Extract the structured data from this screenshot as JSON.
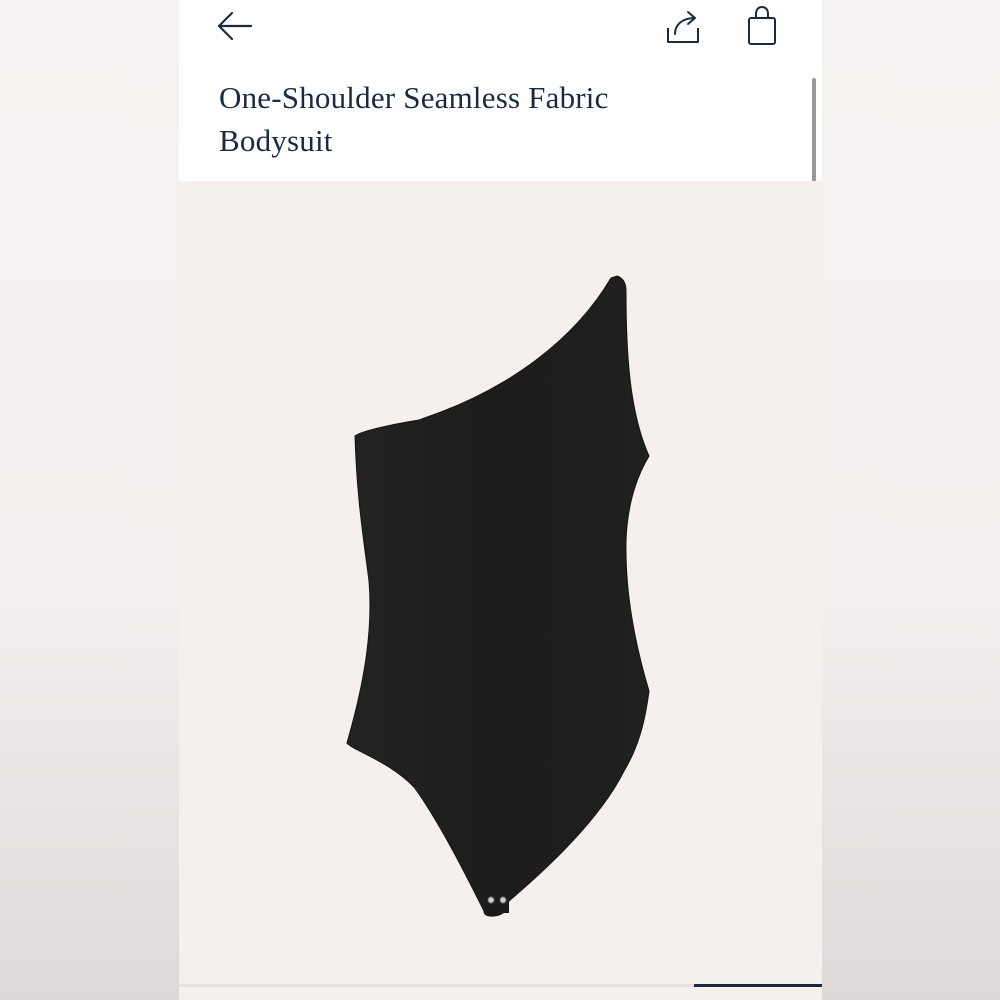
{
  "header": {
    "back_icon": "arrow-left-icon",
    "share_icon": "share-icon",
    "bag_icon": "shopping-bag-icon"
  },
  "product": {
    "title": "One-Shoulder Seamless Fabric Bodysuit",
    "image_alt": "black one-shoulder bodysuit"
  },
  "colors": {
    "title_text": "#1d2a3e",
    "image_background": "#f5f0ee",
    "garment": "#1c1c1c"
  }
}
